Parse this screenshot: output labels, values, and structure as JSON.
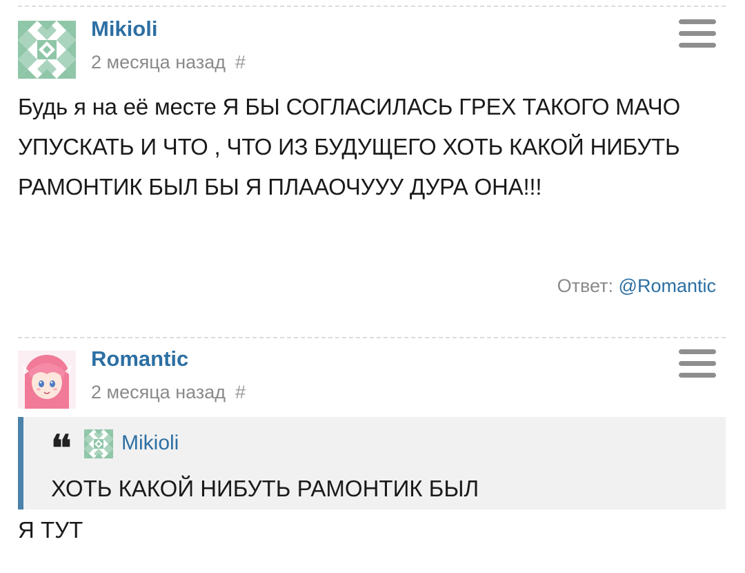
{
  "comments": [
    {
      "author": "Mikioli",
      "time": "2 месяца назад",
      "permalink": "#",
      "text": "Будь я на её месте Я БЫ СОГЛАСИЛАСЬ ГРЕХ ТАКОГО МАЧО УПУСКАТЬ И ЧТО , ЧТО ИЗ БУДУЩЕГО ХОТЬ КАКОЙ НИБУТЬ РАМОНТИК БЫЛ БЫ Я ПЛААОЧУУУ ДУРА ОНА!!!",
      "reply_prefix": "Ответ:",
      "reply_to": "@Romantic"
    },
    {
      "author": "Romantic",
      "time": "2 месяца назад",
      "permalink": "#",
      "quote": {
        "mark": "❛❛",
        "author": "Mikioli",
        "text": "ХОТЬ КАКОЙ НИБУТЬ РАМОНТИК БЫЛ"
      },
      "text": "Я ТУТ"
    }
  ],
  "colors": {
    "link": "#2c6fa3",
    "muted": "#8a8a8a",
    "quote_bar": "#4a82ab",
    "quote_bg": "#f1f1f2",
    "identicon": "#8fc6a8"
  },
  "icons": {
    "menu": "hamburger-menu-icon",
    "quote": "quote-icon"
  }
}
